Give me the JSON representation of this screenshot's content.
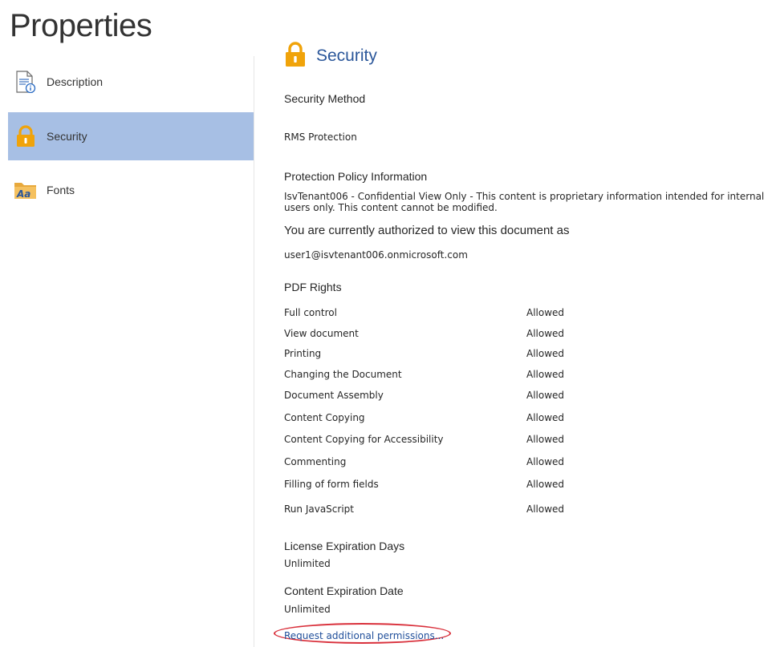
{
  "page": {
    "title": "Properties"
  },
  "sidebar": {
    "items": [
      {
        "label": "Description",
        "icon": "document-info-icon",
        "selected": false
      },
      {
        "label": "Security",
        "icon": "lock-icon",
        "selected": true
      },
      {
        "label": "Fonts",
        "icon": "fonts-folder-icon",
        "selected": false
      }
    ]
  },
  "security": {
    "title": "Security",
    "method_label": "Security Method",
    "method_value": "RMS Protection",
    "policy_heading": "Protection Policy Information",
    "policy_text": "IsvTenant006 - Confidential View Only - This content is proprietary information intended for internal users only. This content cannot be modified.",
    "authorized_heading": "You are currently authorized to view this document as",
    "authorized_user": "user1@isvtenant006.onmicrosoft.com",
    "rights_heading": "PDF Rights",
    "rights": [
      {
        "name": "Full control",
        "value": "Allowed"
      },
      {
        "name": "View document",
        "value": "Allowed"
      },
      {
        "name": "Printing",
        "value": "Allowed"
      },
      {
        "name": "Changing the Document",
        "value": "Allowed"
      },
      {
        "name": "Document Assembly",
        "value": "Allowed"
      },
      {
        "name": "Content Copying",
        "value": "Allowed"
      },
      {
        "name": "Content Copying for Accessibility",
        "value": "Allowed"
      },
      {
        "name": "Commenting",
        "value": "Allowed"
      },
      {
        "name": "Filling of form fields",
        "value": "Allowed"
      },
      {
        "name": "Run JavaScript",
        "value": "Allowed"
      }
    ],
    "license_heading": "License Expiration Days",
    "license_value": "Unlimited",
    "content_exp_heading": "Content Expiration Date",
    "content_exp_value": "Unlimited",
    "request_link": "Request additional permissions..."
  },
  "colors": {
    "selected_bg": "#a7bfe4",
    "title_blue": "#2b579a",
    "lock_orange": "#f0a30a",
    "highlight_red": "#d9303b"
  }
}
